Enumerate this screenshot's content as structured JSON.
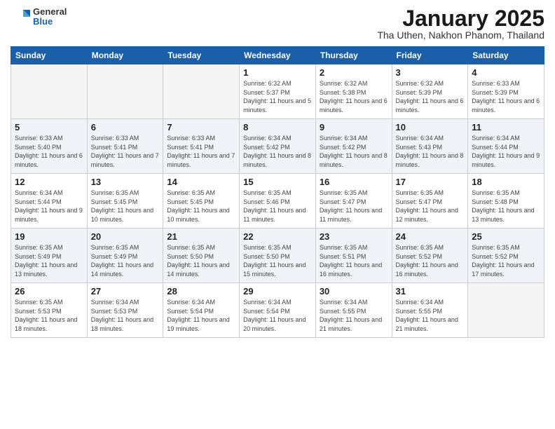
{
  "header": {
    "logo_general": "General",
    "logo_blue": "Blue",
    "month_title": "January 2025",
    "location": "Tha Uthen, Nakhon Phanom, Thailand"
  },
  "weekdays": [
    "Sunday",
    "Monday",
    "Tuesday",
    "Wednesday",
    "Thursday",
    "Friday",
    "Saturday"
  ],
  "weeks": [
    [
      {
        "day": "",
        "empty": true
      },
      {
        "day": "",
        "empty": true
      },
      {
        "day": "",
        "empty": true
      },
      {
        "day": "1",
        "sunrise": "6:32 AM",
        "sunset": "5:37 PM",
        "daylight": "11 hours and 5 minutes."
      },
      {
        "day": "2",
        "sunrise": "6:32 AM",
        "sunset": "5:38 PM",
        "daylight": "11 hours and 6 minutes."
      },
      {
        "day": "3",
        "sunrise": "6:32 AM",
        "sunset": "5:39 PM",
        "daylight": "11 hours and 6 minutes."
      },
      {
        "day": "4",
        "sunrise": "6:33 AM",
        "sunset": "5:39 PM",
        "daylight": "11 hours and 6 minutes."
      }
    ],
    [
      {
        "day": "5",
        "sunrise": "6:33 AM",
        "sunset": "5:40 PM",
        "daylight": "11 hours and 6 minutes."
      },
      {
        "day": "6",
        "sunrise": "6:33 AM",
        "sunset": "5:41 PM",
        "daylight": "11 hours and 7 minutes."
      },
      {
        "day": "7",
        "sunrise": "6:33 AM",
        "sunset": "5:41 PM",
        "daylight": "11 hours and 7 minutes."
      },
      {
        "day": "8",
        "sunrise": "6:34 AM",
        "sunset": "5:42 PM",
        "daylight": "11 hours and 8 minutes."
      },
      {
        "day": "9",
        "sunrise": "6:34 AM",
        "sunset": "5:42 PM",
        "daylight": "11 hours and 8 minutes."
      },
      {
        "day": "10",
        "sunrise": "6:34 AM",
        "sunset": "5:43 PM",
        "daylight": "11 hours and 8 minutes."
      },
      {
        "day": "11",
        "sunrise": "6:34 AM",
        "sunset": "5:44 PM",
        "daylight": "11 hours and 9 minutes."
      }
    ],
    [
      {
        "day": "12",
        "sunrise": "6:34 AM",
        "sunset": "5:44 PM",
        "daylight": "11 hours and 9 minutes."
      },
      {
        "day": "13",
        "sunrise": "6:35 AM",
        "sunset": "5:45 PM",
        "daylight": "11 hours and 10 minutes."
      },
      {
        "day": "14",
        "sunrise": "6:35 AM",
        "sunset": "5:45 PM",
        "daylight": "11 hours and 10 minutes."
      },
      {
        "day": "15",
        "sunrise": "6:35 AM",
        "sunset": "5:46 PM",
        "daylight": "11 hours and 11 minutes."
      },
      {
        "day": "16",
        "sunrise": "6:35 AM",
        "sunset": "5:47 PM",
        "daylight": "11 hours and 11 minutes."
      },
      {
        "day": "17",
        "sunrise": "6:35 AM",
        "sunset": "5:47 PM",
        "daylight": "11 hours and 12 minutes."
      },
      {
        "day": "18",
        "sunrise": "6:35 AM",
        "sunset": "5:48 PM",
        "daylight": "11 hours and 13 minutes."
      }
    ],
    [
      {
        "day": "19",
        "sunrise": "6:35 AM",
        "sunset": "5:49 PM",
        "daylight": "11 hours and 13 minutes."
      },
      {
        "day": "20",
        "sunrise": "6:35 AM",
        "sunset": "5:49 PM",
        "daylight": "11 hours and 14 minutes."
      },
      {
        "day": "21",
        "sunrise": "6:35 AM",
        "sunset": "5:50 PM",
        "daylight": "11 hours and 14 minutes."
      },
      {
        "day": "22",
        "sunrise": "6:35 AM",
        "sunset": "5:50 PM",
        "daylight": "11 hours and 15 minutes."
      },
      {
        "day": "23",
        "sunrise": "6:35 AM",
        "sunset": "5:51 PM",
        "daylight": "11 hours and 16 minutes."
      },
      {
        "day": "24",
        "sunrise": "6:35 AM",
        "sunset": "5:52 PM",
        "daylight": "11 hours and 16 minutes."
      },
      {
        "day": "25",
        "sunrise": "6:35 AM",
        "sunset": "5:52 PM",
        "daylight": "11 hours and 17 minutes."
      }
    ],
    [
      {
        "day": "26",
        "sunrise": "6:35 AM",
        "sunset": "5:53 PM",
        "daylight": "11 hours and 18 minutes."
      },
      {
        "day": "27",
        "sunrise": "6:34 AM",
        "sunset": "5:53 PM",
        "daylight": "11 hours and 18 minutes."
      },
      {
        "day": "28",
        "sunrise": "6:34 AM",
        "sunset": "5:54 PM",
        "daylight": "11 hours and 19 minutes."
      },
      {
        "day": "29",
        "sunrise": "6:34 AM",
        "sunset": "5:54 PM",
        "daylight": "11 hours and 20 minutes."
      },
      {
        "day": "30",
        "sunrise": "6:34 AM",
        "sunset": "5:55 PM",
        "daylight": "11 hours and 21 minutes."
      },
      {
        "day": "31",
        "sunrise": "6:34 AM",
        "sunset": "5:55 PM",
        "daylight": "11 hours and 21 minutes."
      },
      {
        "day": "",
        "empty": true
      }
    ]
  ]
}
